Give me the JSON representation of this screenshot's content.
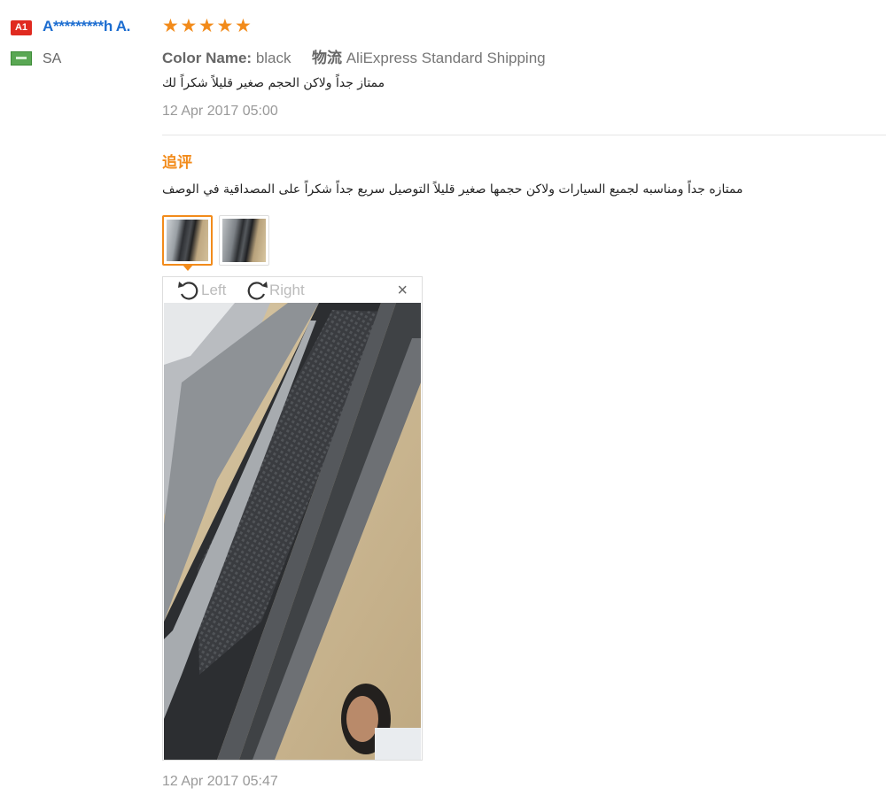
{
  "reviewer": {
    "level_badge": "A1",
    "name": "A*********h A.",
    "country": "SA"
  },
  "rating": {
    "stars": 5,
    "max": 5
  },
  "meta": {
    "color_key": "Color Name:",
    "color_value": "black",
    "logistics_key": "物流",
    "logistics_value": "AliExpress Standard Shipping"
  },
  "comment": "ممتاز جداً ولاكن الحجم صغير قليلاً شكراً لك",
  "date": "12 Apr 2017 05:00",
  "followup": {
    "title": "追评",
    "text": "ممتازه جداً ومناسبه لجميع السيارات ولاكن حجمها صغير قليلاً التوصيل سريع جداً شكراً على المصداقية في الوصف",
    "date": "12 Apr 2017 05:47"
  },
  "viewer": {
    "rotate_left_label": "Left",
    "rotate_right_label": "Right",
    "close_glyph": "×"
  },
  "colors": {
    "accent": "#f28b1b",
    "link": "#1c6dd0",
    "badge": "#e02a20"
  }
}
